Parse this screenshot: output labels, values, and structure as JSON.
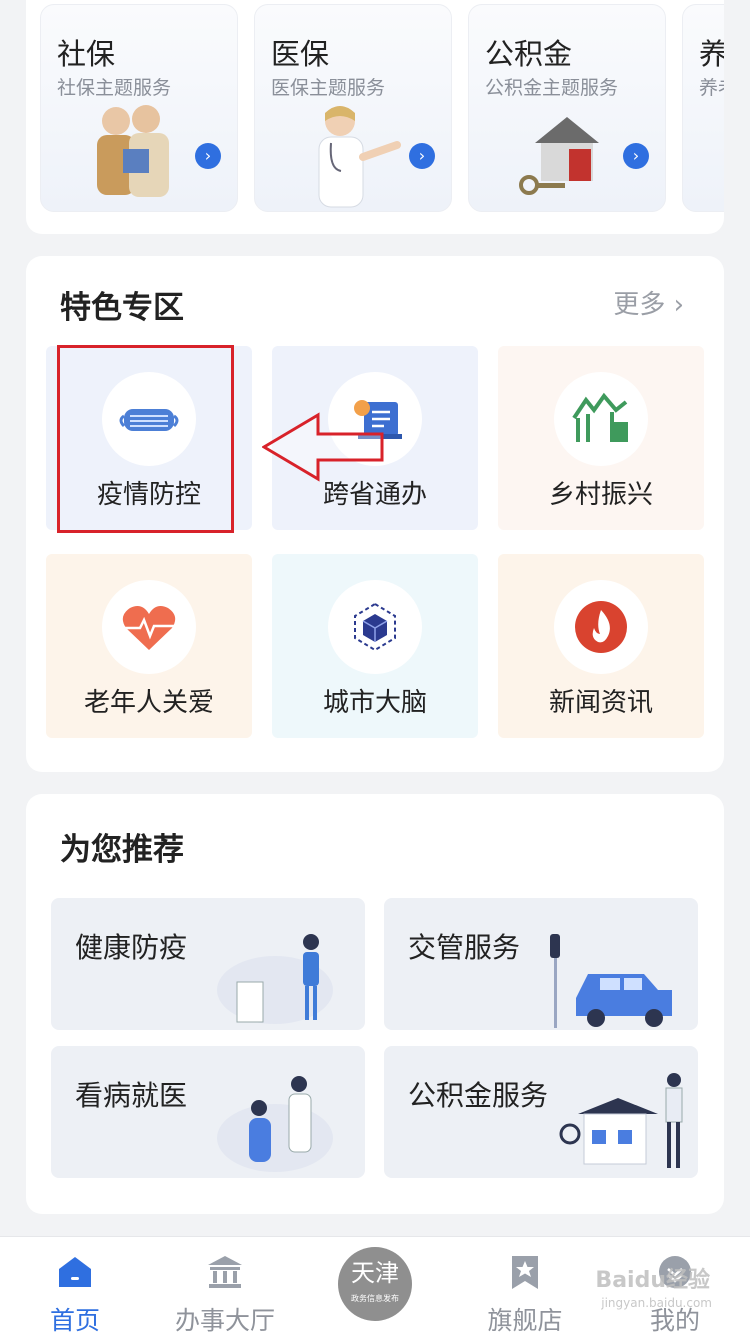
{
  "themes": [
    {
      "title": "社保",
      "sub": "社保主题服务"
    },
    {
      "title": "医保",
      "sub": "医保主题服务"
    },
    {
      "title": "公积金",
      "sub": "公积金主题服务"
    },
    {
      "title": "养",
      "sub": "养老"
    }
  ],
  "featured": {
    "title": "特色专区",
    "more": "更多",
    "items": [
      {
        "label": "疫情防控",
        "bg": "#eef2fb"
      },
      {
        "label": "跨省通办",
        "bg": "#eef2fb"
      },
      {
        "label": "乡村振兴",
        "bg": "#fdf6f2"
      },
      {
        "label": "老年人关爱",
        "bg": "#fdf4ea"
      },
      {
        "label": "城市大脑",
        "bg": "#eef8fb"
      },
      {
        "label": "新闻资讯",
        "bg": "#fdf4ea"
      }
    ]
  },
  "recommend": {
    "title": "为您推荐",
    "items": [
      {
        "label": "健康防疫"
      },
      {
        "label": "交管服务"
      },
      {
        "label": "看病就医"
      },
      {
        "label": "公积金服务"
      }
    ]
  },
  "tabbar": {
    "items": [
      {
        "label": "首页",
        "icon": "home-icon"
      },
      {
        "label": "办事大厅",
        "icon": "bank-icon"
      },
      {
        "label": "旗舰店",
        "icon": "bookmark-star-icon"
      },
      {
        "label": "我的",
        "icon": "user-icon"
      }
    ],
    "center_big": "天津",
    "center_small": "政务信息发布"
  },
  "watermark": {
    "text": "Baidu经验",
    "sub": "jingyan.baidu.com"
  },
  "colors": {
    "accent": "#2f6fe0",
    "highlight": "#d8222a"
  }
}
